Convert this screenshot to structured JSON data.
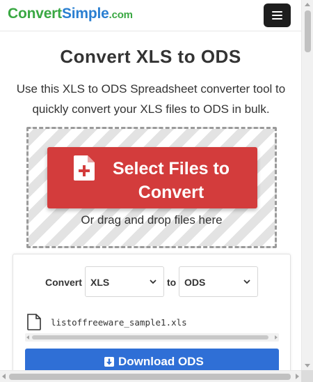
{
  "header": {
    "logo_part1": "Convert",
    "logo_part2": "Simple",
    "logo_part3": ".com",
    "menu_icon": "hamburger-menu-icon"
  },
  "main": {
    "title": "Convert XLS to ODS",
    "description": "Use this XLS to ODS Spreadsheet converter tool to quickly convert your XLS files to ODS in bulk."
  },
  "dropzone": {
    "select_button_label": "Select Files to Convert",
    "select_button_icon": "file-plus-icon",
    "drag_hint": "Or drag and drop files here"
  },
  "converter": {
    "convert_label": "Convert",
    "from_format": "XLS",
    "to_label": "to",
    "to_format": "ODS",
    "file_icon": "file-icon",
    "file_name": "listoffreeware_sample1.xls",
    "download_label": "Download ODS",
    "download_icon": "download-icon"
  },
  "colors": {
    "logo_green": "#3aa843",
    "logo_blue": "#2a7fd1",
    "select_button_red": "#d33c3c",
    "download_button_blue": "#2f6fd6",
    "menu_button_dark": "#1e1e1e"
  }
}
